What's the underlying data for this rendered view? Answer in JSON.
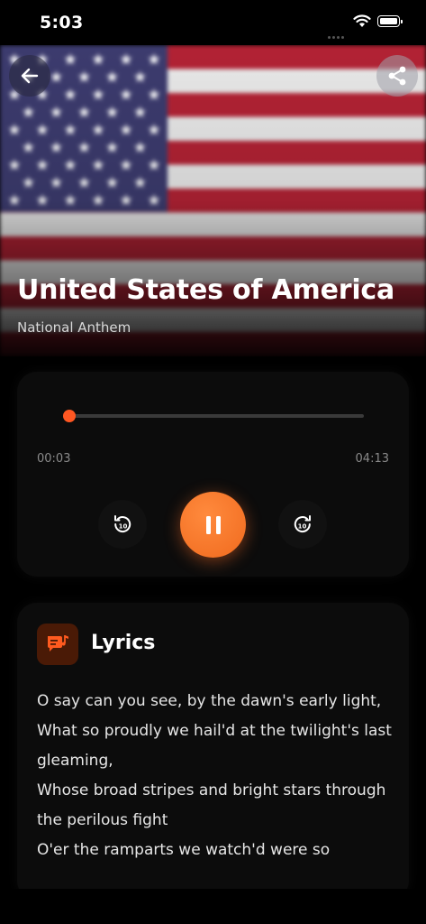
{
  "status_bar": {
    "time": "5:03"
  },
  "header": {
    "title": "United States of America",
    "subtitle": "National Anthem",
    "back_icon": "arrow-left-icon",
    "share_icon": "share-icon"
  },
  "player": {
    "current_time": "00:03",
    "total_time": "04:13",
    "progress": 0.012,
    "rewind_label": "10",
    "forward_label": "10",
    "state": "playing",
    "accent": "#ff6a2b"
  },
  "lyrics": {
    "heading": "Lyrics",
    "icon": "lyrics-icon",
    "lines": [
      "O say can you see, by the dawn's early light,",
      "What so proudly we hail'd at the twilight's last gleaming,",
      "Whose broad stripes and bright stars through the perilous fight",
      "O'er the ramparts we watch'd were so"
    ]
  }
}
